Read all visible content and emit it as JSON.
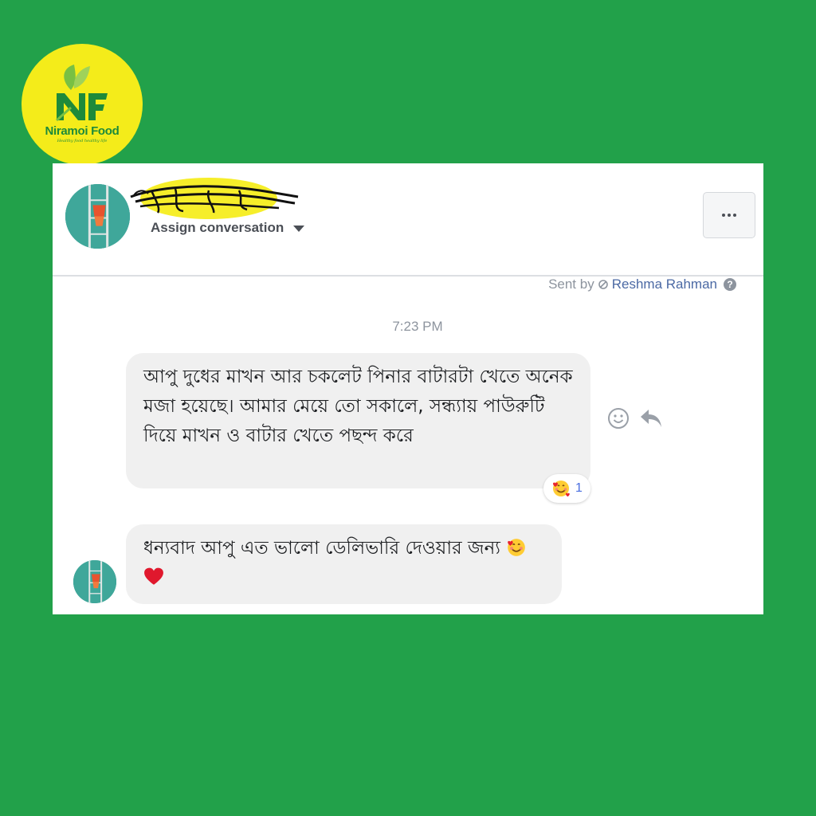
{
  "logo": {
    "name": "Niramoi Food",
    "tagline": "Healthy food healthy life",
    "monogram": "NF",
    "colors": {
      "background": "#f4ec1a",
      "accent": "#1e8a3a",
      "leaf": "#79c043"
    }
  },
  "conversation": {
    "contact_name_redacted": true,
    "assign_label": "Assign conversation",
    "more_options_icon": "more-dots-icon",
    "sent_by_prefix": "Sent by",
    "agent_name": "Reshma Rahman",
    "timestamp": "7:23 PM",
    "messages": [
      {
        "direction": "incoming",
        "text": "আপু দুধের মাখন আর চকলেট পিনার বাটারটা খেতে অনেক মজা হয়েছে। আমার মেয়ে তো সকালে, সন্ধ্যায় পাউরুটি দিয়ে মাখন ও বাটার খেতে পছন্দ করে",
        "reaction": {
          "emoji": "smiling-face-with-hearts",
          "count": "1"
        }
      },
      {
        "direction": "outgoing-page",
        "text": "ধন্যবাদ আপু এত ভালো ডেলিভারি দেওয়ার জন্য",
        "trailing_emojis": [
          "smiling-face-with-hearts",
          "red-heart"
        ]
      }
    ]
  },
  "colors": {
    "page_background": "#22a14a",
    "panel_background": "#ffffff",
    "bubble_background": "#f0f0f0",
    "agent_link": "#4b69a4",
    "muted_text": "#8d949e"
  }
}
